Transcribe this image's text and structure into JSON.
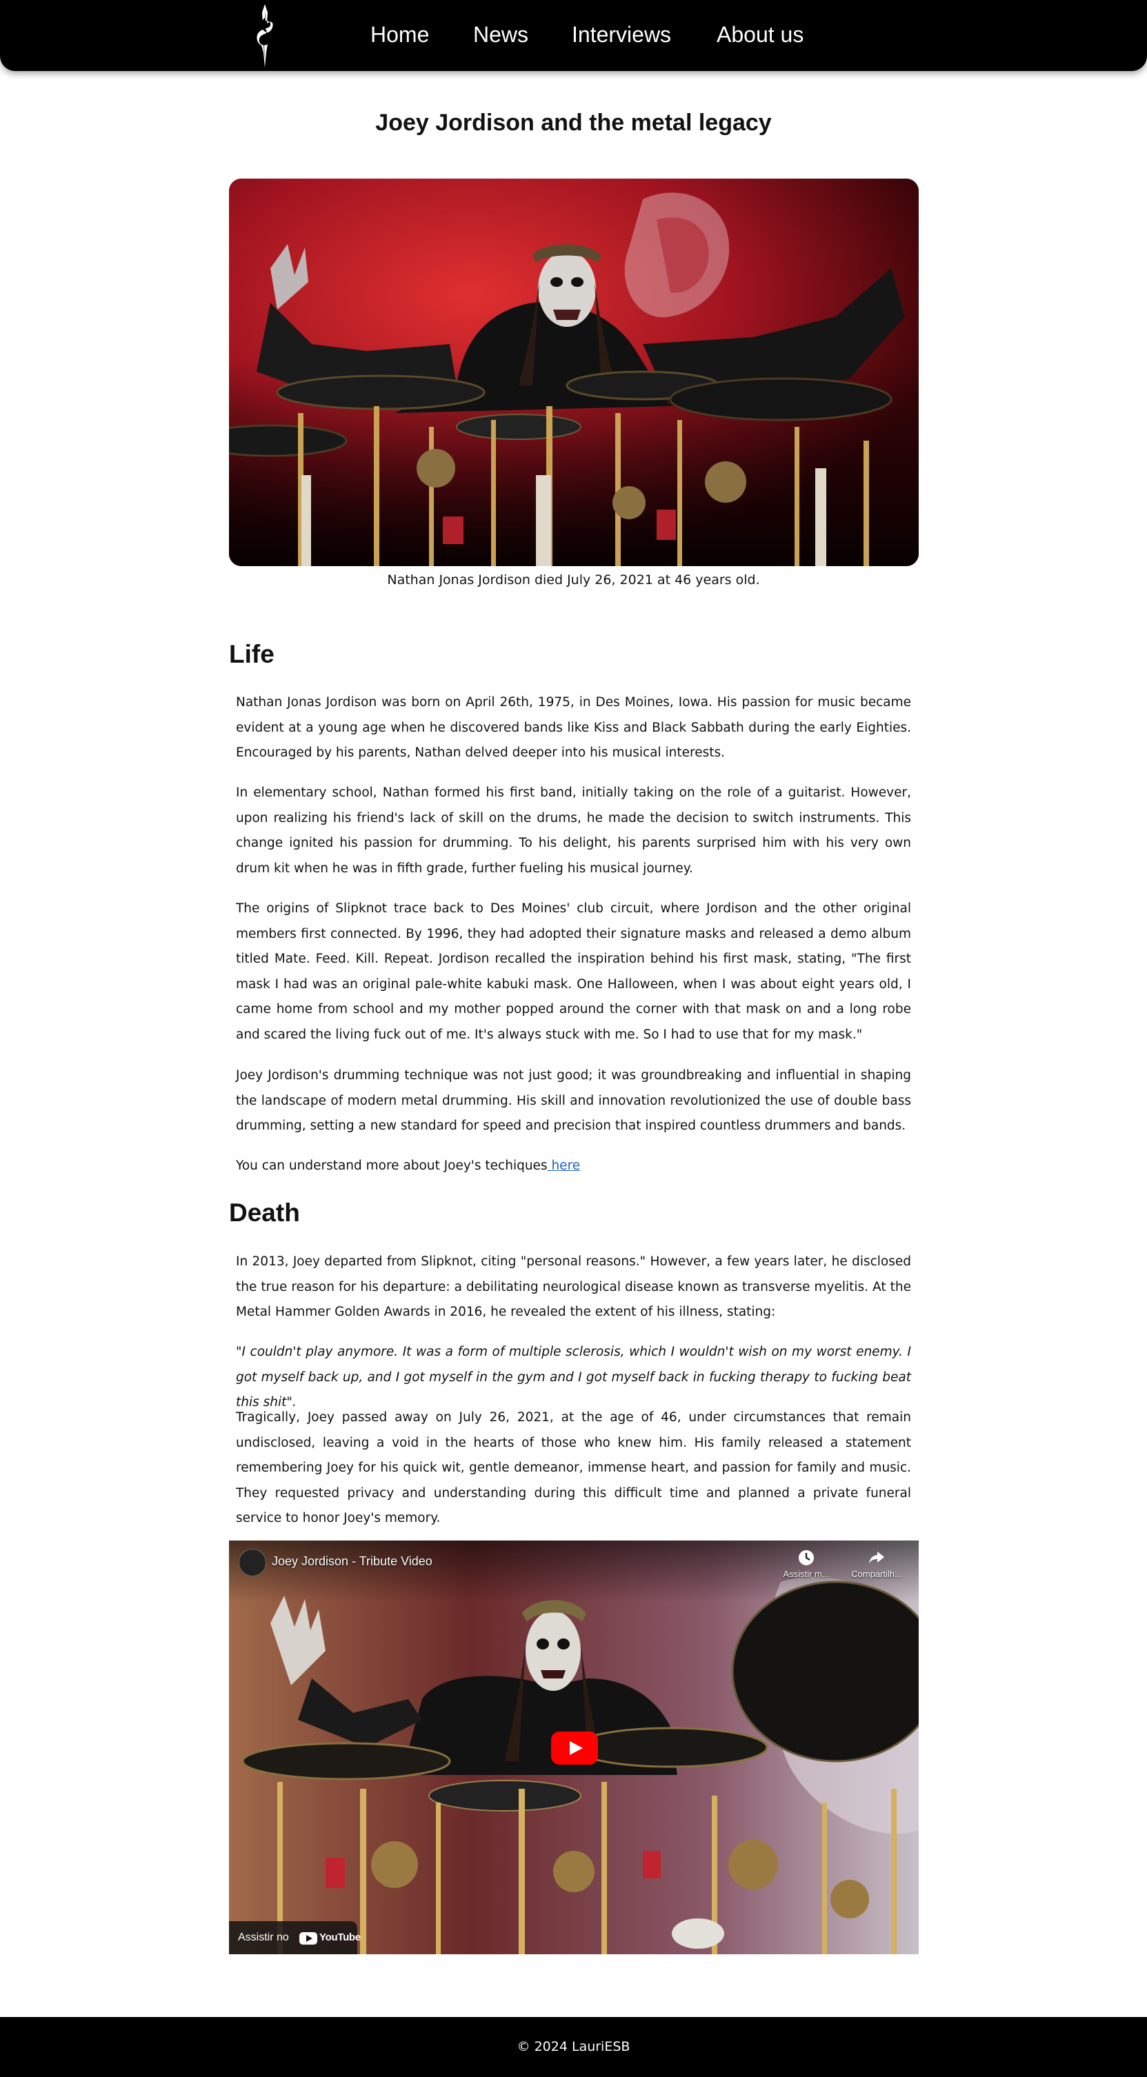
{
  "nav": {
    "logo_icon": "slipknot-s-logo-icon",
    "links": [
      "Home",
      "News",
      "Interviews",
      "About us"
    ]
  },
  "article": {
    "title": "Joey Jordison and the metal legacy",
    "hero_caption": "Nathan Jonas Jordison died July 26, 2021 at 46 years old."
  },
  "life": {
    "heading": "Life",
    "paragraphs": [
      "Nathan Jonas Jordison was born on April 26th, 1975, in Des Moines, Iowa. His passion for music became evident at a young age when he discovered bands like Kiss and Black Sabbath during the early Eighties. Encouraged by his parents, Nathan delved deeper into his musical interests.",
      "In elementary school, Nathan formed his first band, initially taking on the role of a guitarist. However, upon realizing his friend's lack of skill on the drums, he made the decision to switch instruments. This change ignited his passion for drumming. To his delight, his parents surprised him with his very own drum kit when he was in fifth grade, further fueling his musical journey.",
      "The origins of Slipknot trace back to Des Moines' club circuit, where Jordison and the other original members first connected. By 1996, they had adopted their signature masks and released a demo album titled Mate. Feed. Kill. Repeat. Jordison recalled the inspiration behind his first mask, stating, \"The first mask I had was an original pale-white kabuki mask. One Halloween, when I was about eight years old, I came home from school and my mother popped around the corner with that mask on and a long robe and scared the living fuck out of me. It's always stuck with me. So I had to use that for my mask.\"",
      "Joey Jordison's drumming technique was not just good; it was groundbreaking and influential in shaping the landscape of modern metal drumming. His skill and innovation revolutionized the use of double bass drumming, setting a new standard for speed and precision that inspired countless drummers and bands."
    ],
    "more_text": "You can understand more about Joey's techiques",
    "more_link": " here"
  },
  "death": {
    "heading": "Death",
    "paragraphs": [
      "In 2013, Joey departed from Slipknot, citing \"personal reasons.\" However, a few years later, he disclosed the true reason for his departure: a debilitating neurological disease known as transverse myelitis. At the Metal Hammer Golden Awards in 2016, he revealed the extent of his illness, stating:",
      "\"I couldn't play anymore. It was a form of multiple sclerosis, which I wouldn't wish on my worst enemy. I got myself back up, and I got myself in the gym and I got myself back in fucking therapy to fucking beat this shit\".",
      "Tragically, Joey passed away on July 26, 2021, at the age of 46, under circumstances that remain undisclosed, leaving a void in the hearts of those who knew him. His family released a statement remembering Joey for his quick wit, gentle demeanor, immense heart, and passion for family and music. They requested privacy and understanding during this difficult time and planned a private funeral service to honor Joey's memory."
    ]
  },
  "video": {
    "title": "Joey Jordison - Tribute Video",
    "watch_later": "Assistir m...",
    "share": "Compartilh...",
    "watch_on": "Assistir no",
    "youtube": "YouTube"
  },
  "footer": {
    "copyright": "© 2024 LauriESB"
  }
}
